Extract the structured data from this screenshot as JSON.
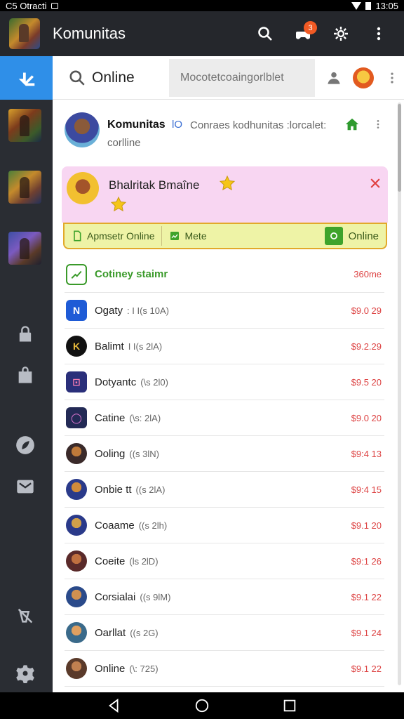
{
  "status": {
    "left_text": "C5 Otracti",
    "right_time": "13:05"
  },
  "app_bar": {
    "title": "Komunitas",
    "notification_count": "3"
  },
  "search": {
    "label": "Online",
    "placeholder": "Mocotetcoaingorlblet"
  },
  "community": {
    "name": "Komunitas",
    "tag": "lO",
    "description": "Conraes kodhunitas :lorcalet:",
    "sub": "corlline"
  },
  "feature": {
    "title": "Bhalritak Bmaîne",
    "actions": [
      {
        "label": "Apmsetr Online",
        "icon": "document-icon"
      },
      {
        "label": "Mete",
        "icon": "chart-icon"
      }
    ],
    "online_label": "Online"
  },
  "list": [
    {
      "name": "Cotiney staimr",
      "meta": "",
      "price": "360me",
      "icon": "chart-check-icon",
      "color": "#ffffff",
      "border": "#3a9a2a",
      "glyph": ""
    },
    {
      "name": "Ogaty",
      "meta": ": I I(s 10A)",
      "price": "$9.0 29",
      "icon": "n-logo-icon",
      "color": "#1e5bd6",
      "glyph": "N"
    },
    {
      "name": "Balimt",
      "meta": "I I(s 2lA)",
      "price": "$9.2.29",
      "icon": "gold-logo-icon",
      "color": "#111111",
      "glyph": "K"
    },
    {
      "name": "Dotyantc",
      "meta": "(\\s 2l0)",
      "price": "$9.5 20",
      "icon": "box-logo-icon",
      "color": "#2a2f7a",
      "glyph": "⊡"
    },
    {
      "name": "Catine",
      "meta": "(\\s: 2lA)",
      "price": "$9.0 20",
      "icon": "ring-logo-icon",
      "color": "#232a55",
      "glyph": "◯"
    },
    {
      "name": "Ooling",
      "meta": "((s 3lN)",
      "price": "$9:4 13",
      "icon": "game-avatar-icon",
      "color": "#3a2a2a",
      "glyph": ""
    },
    {
      "name": "Onbie tt",
      "meta": "((s 2lA)",
      "price": "$9:4 15",
      "icon": "game-avatar-icon",
      "color": "#2a3a8a",
      "glyph": ""
    },
    {
      "name": "Coaame",
      "meta": "((s 2lh)",
      "price": "$9.1 20",
      "icon": "game-avatar-icon",
      "color": "#2a3a8a",
      "glyph": ""
    },
    {
      "name": "Coeite",
      "meta": "(ls 2lD)",
      "price": "$9:1 26",
      "icon": "game-avatar-icon",
      "color": "#5a2a2a",
      "glyph": ""
    },
    {
      "name": "Corsialai",
      "meta": "((s 9lM)",
      "price": "$9.1 22",
      "icon": "game-avatar-icon",
      "color": "#2a4a8a",
      "glyph": ""
    },
    {
      "name": "Oarllat",
      "meta": "((s 2G)",
      "price": "$9.1 24",
      "icon": "game-avatar-icon",
      "color": "#3a6a8a",
      "glyph": ""
    },
    {
      "name": "Online",
      "meta": "(\\: 725)",
      "price": "$9.1 22",
      "icon": "game-avatar-icon",
      "color": "#5a3a2a",
      "glyph": ""
    }
  ]
}
